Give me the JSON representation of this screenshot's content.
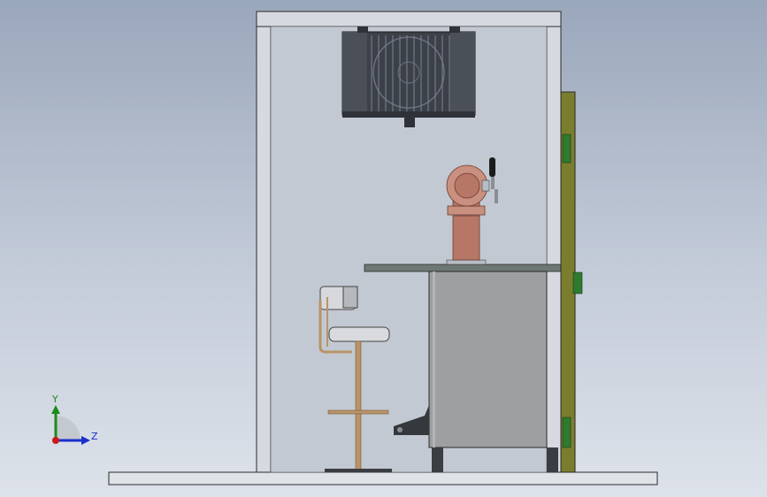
{
  "triad": {
    "y_label": "Y",
    "z_label": "Z"
  },
  "colors": {
    "background_top": "#9aa7bb",
    "background_bottom": "#dde2ea",
    "enclosure_outline": "#2a2a2a",
    "enclosure_fill": "#c2c8d0",
    "counter_top": "#6f7774",
    "cabinet": "#9d9fa1",
    "column": "#b77766",
    "stool": "#b99468",
    "door_panel": "#7b7d2e",
    "hinge": "#2e7a2e",
    "axis_y": "#1a8c1a",
    "axis_z": "#1a2fcc",
    "axis_origin": "#cc1a1a"
  },
  "icons": {
    "triad": "coordinate-triad-icon",
    "fan": "condenser-fan-icon",
    "tap": "beer-tap-icon"
  }
}
